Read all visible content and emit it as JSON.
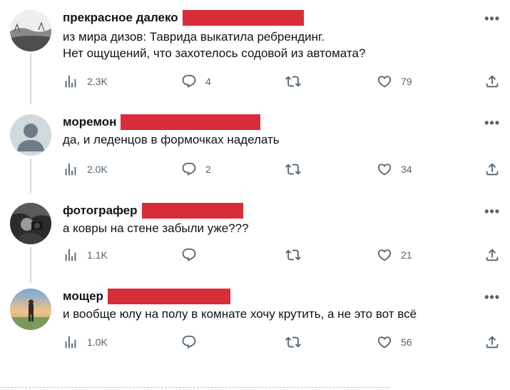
{
  "tweets": [
    {
      "author": "прекрасное далеко",
      "text": "из мира дизов: Таврида выкатила ребрендинг.\nНет ощущений, что захотелось содовой из автомата?",
      "views": "2.3K",
      "replies": "4",
      "retweets": "",
      "likes": "79"
    },
    {
      "author": "моремон",
      "text": "да, и леденцов в формочках наделать",
      "views": "2.0K",
      "replies": "2",
      "retweets": "",
      "likes": "34"
    },
    {
      "author": "фотографер",
      "text": "а ковры на стене забыли уже???",
      "views": "1.1K",
      "replies": "",
      "retweets": "",
      "likes": "21"
    },
    {
      "author": "мощер",
      "text": "и вообще юлу на полу в комнате хочу крутить, а не это вот всё",
      "views": "1.0K",
      "replies": "",
      "retweets": "",
      "likes": "56"
    }
  ],
  "icons": {
    "views": "bar-chart-icon",
    "reply": "reply-bubble-icon",
    "retweet": "retweet-icon",
    "like": "heart-icon",
    "share": "share-upload-icon",
    "more": "more-dots-icon"
  },
  "colors": {
    "redaction": "#d82c38",
    "icon_gray": "#536471",
    "thread_line": "#cfd9de"
  }
}
